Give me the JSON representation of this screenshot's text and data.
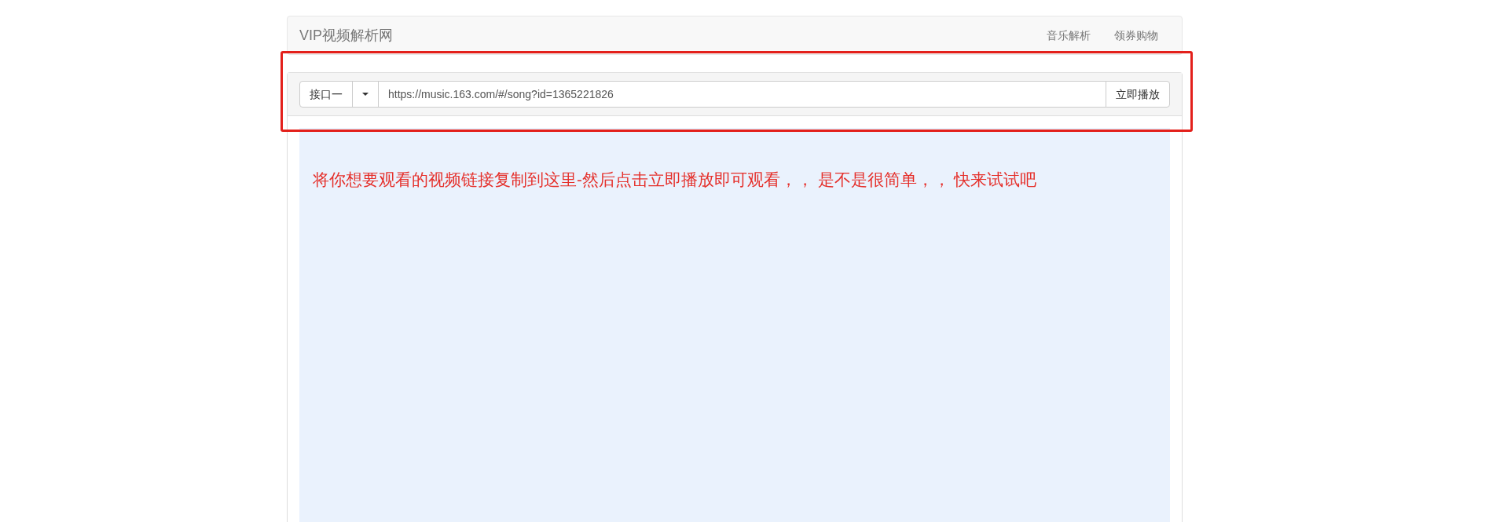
{
  "navbar": {
    "brand": "VIP视频解析网",
    "links": [
      {
        "label": "音乐解析"
      },
      {
        "label": "领券购物"
      }
    ]
  },
  "player_form": {
    "source_button": "接口一",
    "url_field": {
      "value": "https://music.163.com/#/song?id=1365221826"
    },
    "play_button": "立即播放"
  },
  "content": {
    "message": "将你想要观看的视频链接复制到这里-然后点击立即播放即可观看，， 是不是很简单，， 快来试试吧"
  },
  "highlight_box": true
}
